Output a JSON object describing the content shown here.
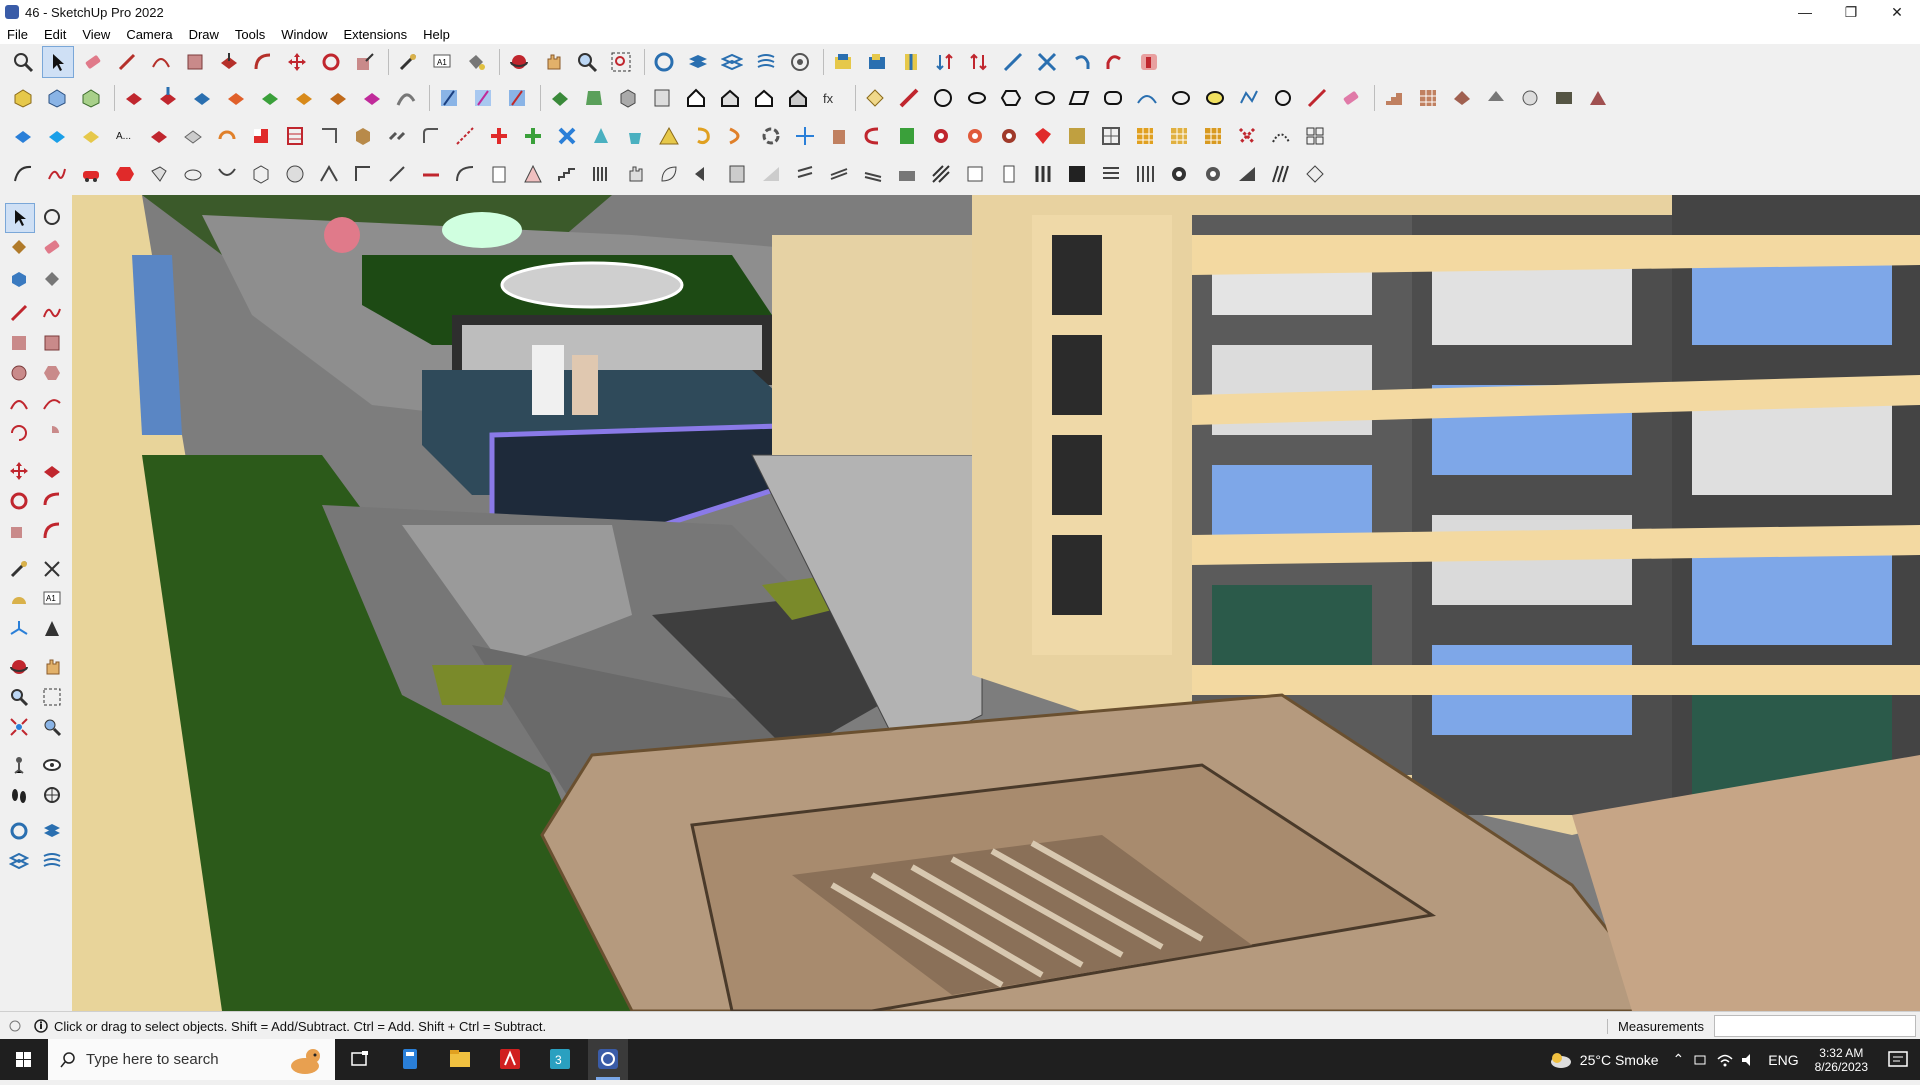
{
  "window": {
    "title": "46 - SketchUp Pro 2022"
  },
  "menu": {
    "items": [
      "File",
      "Edit",
      "View",
      "Camera",
      "Draw",
      "Tools",
      "Window",
      "Extensions",
      "Help"
    ]
  },
  "status": {
    "message": "Click or drag to select objects. Shift = Add/Subtract. Ctrl = Add. Shift + Ctrl = Subtract.",
    "measurements_label": "Measurements",
    "measurements_value": ""
  },
  "taskbar": {
    "search_placeholder": "Type here to search",
    "weather": "25°C  Smoke",
    "language": "ENG",
    "time": "3:32 AM",
    "date": "8/26/2023"
  },
  "colors": {
    "toolbar_bg": "#f0f0f0",
    "taskbar_bg": "#1f1f1f",
    "facade_cream": "#f1d9a8",
    "glass_blue": "#7ea7e8",
    "lawn_green": "#2c5a1a",
    "pavement_gray": "#8a8a8a",
    "roof_tan": "#b59a7e"
  }
}
